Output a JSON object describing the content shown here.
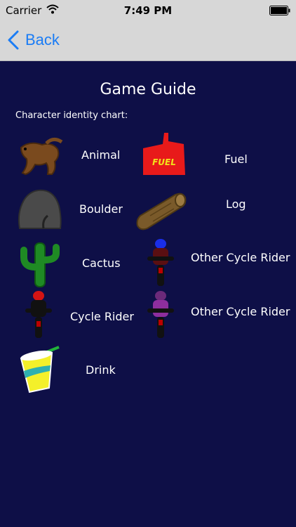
{
  "status": {
    "carrier": "Carrier",
    "time": "7:49 PM"
  },
  "nav": {
    "back_label": "Back"
  },
  "guide": {
    "title": "Game Guide",
    "subtitle": "Character identity chart:",
    "left_items": [
      {
        "label": "Animal",
        "icon": "animal-icon"
      },
      {
        "label": "Boulder",
        "icon": "boulder-icon"
      },
      {
        "label": "Cactus",
        "icon": "cactus-icon"
      },
      {
        "label": "Cycle Rider",
        "icon": "cycle-rider-icon"
      },
      {
        "label": "Drink",
        "icon": "drink-icon"
      }
    ],
    "right_items": [
      {
        "label": "Fuel",
        "icon": "fuel-can-icon"
      },
      {
        "label": "Log",
        "icon": "log-icon"
      },
      {
        "label": "Other Cycle Rider",
        "icon": "other-cycle-rider-blue-icon"
      },
      {
        "label": "Other Cycle Rider",
        "icon": "other-cycle-rider-purple-icon"
      }
    ],
    "fuel_can_text": "FUEL"
  },
  "colors": {
    "background": "#0e0f47",
    "navbar": "#d7d7d7",
    "accent": "#1a7cf5"
  }
}
